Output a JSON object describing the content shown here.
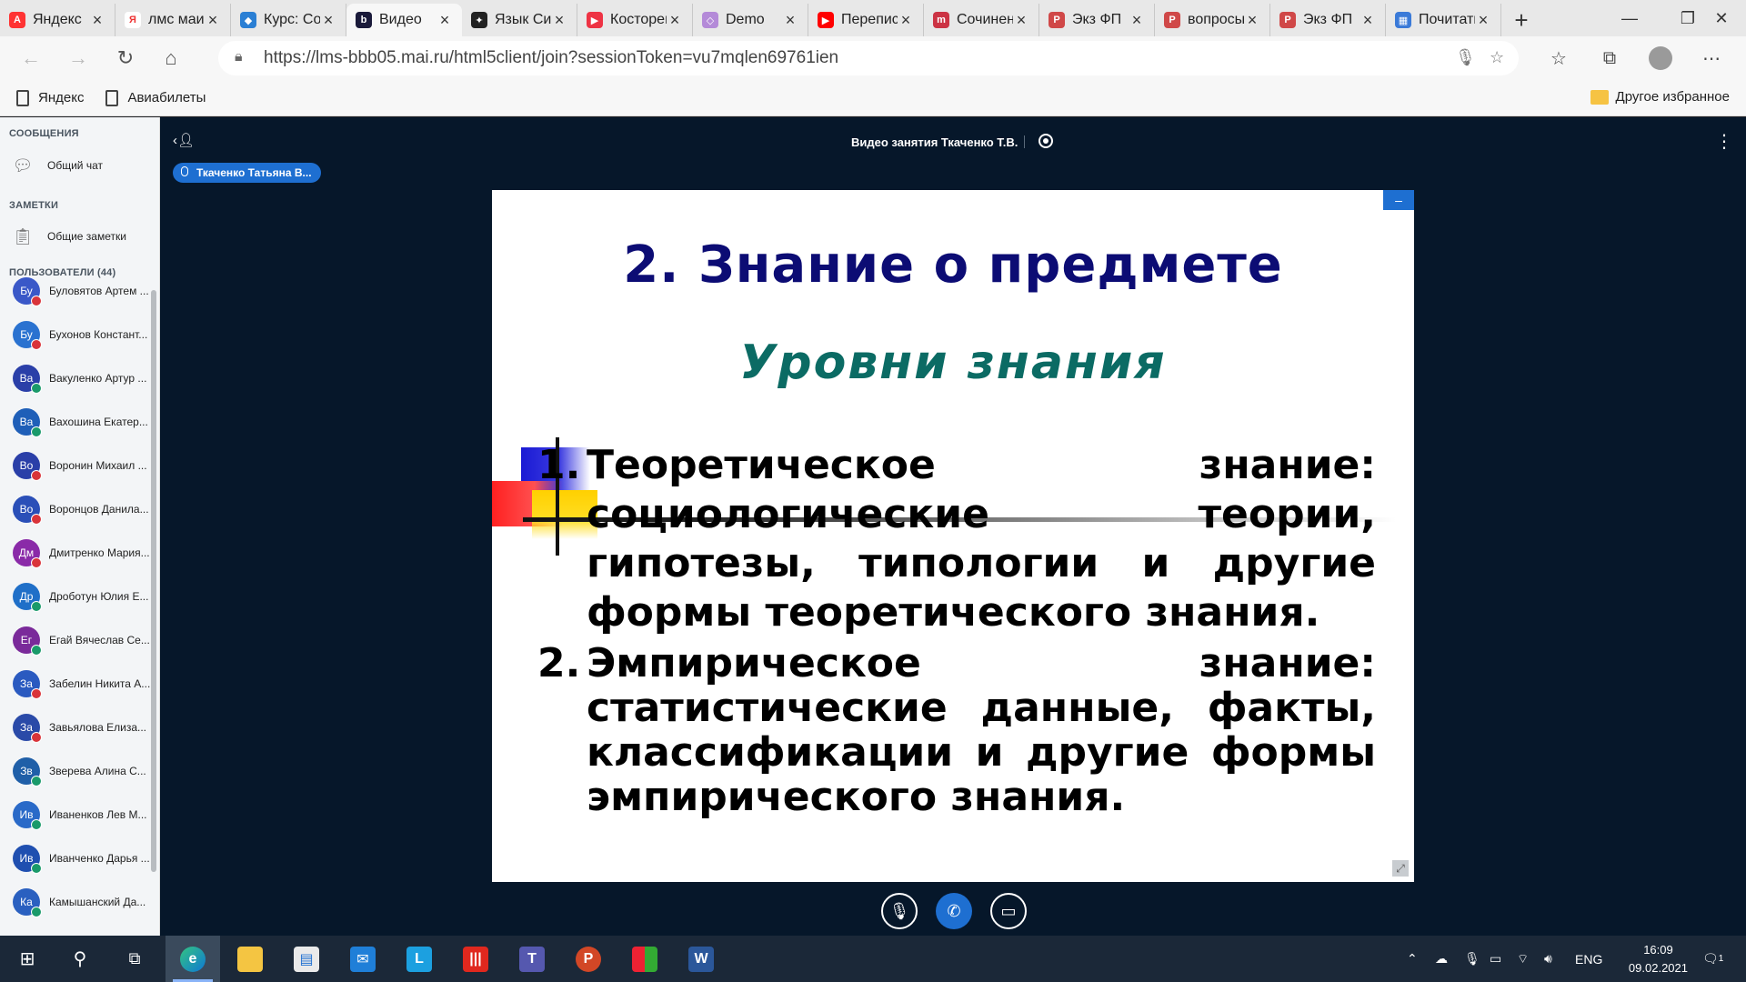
{
  "browser": {
    "tabs": [
      {
        "title": "Яндекс",
        "favicon_color": "#ff3333",
        "favicon_glyph": "А"
      },
      {
        "title": "лмс маи",
        "favicon_color": "#ffffff",
        "favicon_glyph": "Я"
      },
      {
        "title": "Курс: Социология",
        "favicon_color": "#2a7fd4",
        "favicon_glyph": "◆"
      },
      {
        "title": "Видео",
        "favicon_color": "#1a1a3a",
        "favicon_glyph": "b",
        "active": true
      },
      {
        "title": "Язык Си",
        "favicon_color": "#222222",
        "favicon_glyph": "✦"
      },
      {
        "title": "Косторев",
        "favicon_color": "#ee3344",
        "favicon_glyph": "▶"
      },
      {
        "title": "Demo",
        "favicon_color": "#b48ad8",
        "favicon_glyph": "◇"
      },
      {
        "title": "Перепись",
        "favicon_color": "#ff0000",
        "favicon_glyph": "▶"
      },
      {
        "title": "Сочинение",
        "favicon_color": "#cc3344",
        "favicon_glyph": "m"
      },
      {
        "title": "Экз ФП",
        "favicon_color": "#d04848",
        "favicon_glyph": "P"
      },
      {
        "title": "вопросы",
        "favicon_color": "#d04848",
        "favicon_glyph": "P"
      },
      {
        "title": "Экз ФП",
        "favicon_color": "#d04848",
        "favicon_glyph": "P"
      },
      {
        "title": "Почитать",
        "favicon_color": "#3a7ad8",
        "favicon_glyph": "▦"
      }
    ],
    "url": "https://lms-bbb05.mai.ru/html5client/join?sessionToken=vu7mqlen69761ien",
    "bookmarks": [
      "Яндекс",
      "Авиабилеты"
    ],
    "other_bookmarks": "Другое избранное"
  },
  "sidebar": {
    "messages_header": "СООБЩЕНИЯ",
    "public_chat": "Общий чат",
    "notes_header": "ЗАМЕТКИ",
    "shared_notes": "Общие заметки",
    "users_header": "ПОЛЬЗОВАТЕЛИ (44)",
    "users": [
      {
        "initials": "Бу",
        "name": "Буловятов Артем ...",
        "color": "#3a58c8",
        "status": "muted"
      },
      {
        "initials": "Бу",
        "name": "Бухонов Констант...",
        "color": "#2a72d0",
        "status": "muted"
      },
      {
        "initials": "Ва",
        "name": "Вакуленко Артур ...",
        "color": "#2a3fa8",
        "status": "listen"
      },
      {
        "initials": "Ва",
        "name": "Вахошина Екатер...",
        "color": "#1f5fb8",
        "status": "listen"
      },
      {
        "initials": "Во",
        "name": "Воронин Михаил ...",
        "color": "#2a3fa8",
        "status": "muted"
      },
      {
        "initials": "Во",
        "name": "Воронцов Данила...",
        "color": "#2a4fb8",
        "status": "muted"
      },
      {
        "initials": "Дм",
        "name": "Дмитренко Мария...",
        "color": "#8a2aa8",
        "status": "muted"
      },
      {
        "initials": "Др",
        "name": "Дроботун Юлия Е...",
        "color": "#1f6fc8",
        "status": "listen"
      },
      {
        "initials": "Ег",
        "name": "Егай Вячеслав Се...",
        "color": "#7a2a9a",
        "status": "listen"
      },
      {
        "initials": "За",
        "name": "Забелин Никита А...",
        "color": "#2a5ac0",
        "status": "muted"
      },
      {
        "initials": "За",
        "name": "Завьялова Елиза...",
        "color": "#2a4aa8",
        "status": "muted"
      },
      {
        "initials": "Зв",
        "name": "Зверева Алина С...",
        "color": "#1f5fa8",
        "status": "listen"
      },
      {
        "initials": "Ив",
        "name": "Иваненков Лев М...",
        "color": "#2a6ac8",
        "status": "listen"
      },
      {
        "initials": "Ив",
        "name": "Иванченко Дарья ...",
        "color": "#1f4fb0",
        "status": "listen"
      },
      {
        "initials": "Ка",
        "name": "Камышанский Да...",
        "color": "#2a60c0",
        "status": "listen"
      }
    ]
  },
  "meeting": {
    "title": "Видео занятия Ткаченко Т.В.",
    "talker": "Ткаченко Татьяна В..."
  },
  "slide": {
    "title": "2. Знание о предмете",
    "subtitle": "Уровни знания",
    "items": [
      {
        "num": "1.",
        "text": "Теоретическое знание: социологические теории, гипотезы, типологии и другие формы теоретического знания."
      },
      {
        "num": "2.",
        "text": "Эмпирическое знание: статистические данные, факты, классификации и другие формы эмпирического знания."
      }
    ]
  },
  "taskbar": {
    "lang": "ENG",
    "time": "16:09",
    "date": "09.02.2021",
    "notifications": "1"
  },
  "colors": {
    "muted_status": "#d9343a",
    "listen_status": "#1a9a6a",
    "accent": "#1e6fd1"
  }
}
